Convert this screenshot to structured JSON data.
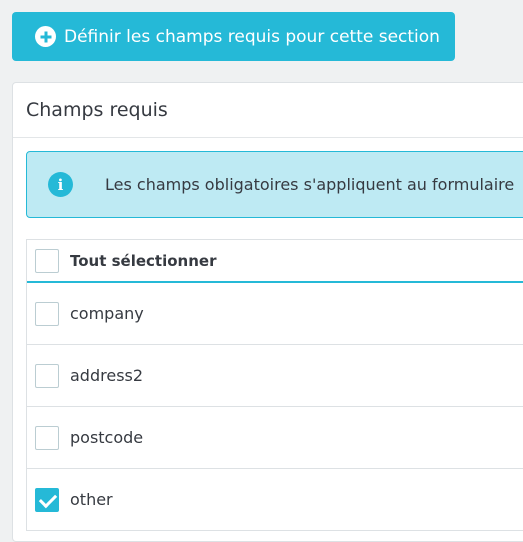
{
  "top_button": {
    "label": "Définir les champs requis pour cette section",
    "icon": "plus-circle-icon"
  },
  "panel": {
    "title": "Champs requis"
  },
  "alert": {
    "icon": "info-icon",
    "icon_glyph": "i",
    "text": "Les champs obligatoires s'appliquent au formulaire"
  },
  "table": {
    "select_all_label": "Tout sélectionner",
    "select_all_checked": false,
    "rows": [
      {
        "label": "company",
        "checked": false
      },
      {
        "label": "address2",
        "checked": false
      },
      {
        "label": "postcode",
        "checked": false
      },
      {
        "label": "other",
        "checked": true
      }
    ]
  },
  "colors": {
    "accent": "#25b9d7",
    "alert_bg": "#beeaf3",
    "page_bg": "#eff1f2",
    "text": "#363a41"
  }
}
